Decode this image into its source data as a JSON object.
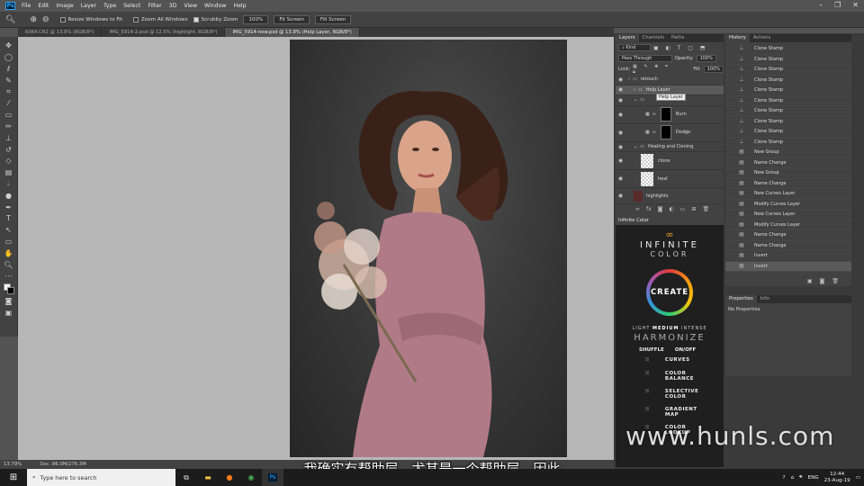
{
  "app": {
    "logo": "Ps"
  },
  "menu": [
    "File",
    "Edit",
    "Image",
    "Layer",
    "Type",
    "Select",
    "Filter",
    "3D",
    "View",
    "Window",
    "Help"
  ],
  "options": {
    "resize": "Resize Windows to Fit",
    "zoom_all": "Zoom All Windows",
    "scrubby": "Scrubby Zoom",
    "b100": "100%",
    "fit": "Fit Screen",
    "fill": "Fill Screen"
  },
  "doc_tabs": [
    "6084.CR2 @ 13.8% (RGB/8*)",
    "IMG_5914-2.psd @ 12.5% (highlight, RGB/8*)",
    "IMG_5914-new.psd @ 13.8% (Help Layer, RGB/8*)"
  ],
  "status": {
    "zoom": "13.79%",
    "doc": "Doc: 86.0M/276.3M"
  },
  "layers": {
    "tabs": [
      "Layers",
      "Channels",
      "Paths"
    ],
    "kind": "Kind",
    "blend": "Pass Through",
    "opacity_label": "Opacity:",
    "opacity": "100%",
    "lock_label": "Lock:",
    "fill_label": "Fill:",
    "fill": "100%",
    "rows": [
      "retouch",
      "Help Layer",
      "",
      "Burn",
      "Dodge",
      "Healing and Cloning",
      "clone",
      "heal",
      "highlights"
    ],
    "tooltip": "Help Layer"
  },
  "infinite": {
    "title": "Infinite Color",
    "brand1": "INFINITE",
    "brand2": "COLOR",
    "create": "CREATE",
    "intensity": [
      "LIGHT",
      "MEDIUM",
      "INTENSE"
    ],
    "harmonize": "HARMONIZE",
    "shuffle": "SHUFFLE",
    "onoff": "ON/OFF",
    "items": [
      "CURVES",
      "COLOR BALANCE",
      "SELECTIVE COLOR",
      "GRADIENT MAP",
      "COLOR LOOKUP"
    ]
  },
  "history": {
    "tabs": [
      "History",
      "Actions"
    ],
    "items": [
      "Clone Stamp",
      "Clone Stamp",
      "Clone Stamp",
      "Clone Stamp",
      "Clone Stamp",
      "Clone Stamp",
      "Clone Stamp",
      "Clone Stamp",
      "Clone Stamp",
      "Clone Stamp",
      "New Group",
      "Name Change",
      "New Group",
      "Name Change",
      "New Curves Layer",
      "Modify Curves Layer",
      "New Curves Layer",
      "Modify Curves Layer",
      "Name Change",
      "Name Change",
      "Invert",
      "Invert"
    ]
  },
  "properties": {
    "tabs": [
      "Properties",
      "Info"
    ],
    "empty": "No Properties"
  },
  "subtitle": "我确实有帮助层，尤其是一个帮助层，因此",
  "watermark": "www.hunls.com",
  "taskbar": {
    "search": "Type here to search",
    "lang": "ENG",
    "time": "12:44",
    "date": "23-Aug-19"
  }
}
